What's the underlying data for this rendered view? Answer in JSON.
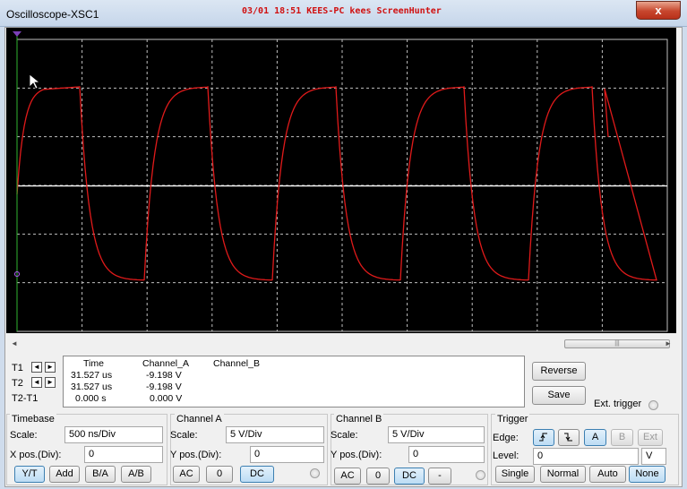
{
  "window": {
    "title": "Oscilloscope-XSC1",
    "watermark": "03/01 18:51 KEES-PC kees ScreenHunter",
    "close_icon": "x"
  },
  "display": {
    "background": "#000000",
    "grid_color": "#bfbfbf",
    "trace_color": "#e01a1a",
    "baseline_color": "#ffffff",
    "cursor_color": "#2fb32f"
  },
  "scrollbar": {
    "left_arrow": "◄",
    "right_arrow": "►",
    "thumb_grip": "|||"
  },
  "readout": {
    "headers": {
      "time": "Time",
      "channel_a": "Channel_A",
      "channel_b": "Channel_B"
    },
    "rows": [
      {
        "label": "T1",
        "time": "31.527 us",
        "channel_a": "-9.198 V",
        "channel_b": ""
      },
      {
        "label": "T2",
        "time": "31.527 us",
        "channel_a": "-9.198 V",
        "channel_b": ""
      },
      {
        "label": "T2-T1",
        "time": "0.000 s",
        "channel_a": "0.000 V",
        "channel_b": ""
      }
    ],
    "arrows": {
      "left": "◄",
      "right": "►"
    }
  },
  "buttons": {
    "reverse": "Reverse",
    "save": "Save",
    "ext_trigger": "Ext. trigger"
  },
  "timebase": {
    "title": "Timebase",
    "scale_label": "Scale:",
    "scale_value": "500 ns/Div",
    "xpos_label": "X pos.(Div):",
    "xpos_value": "0",
    "modes": [
      "Y/T",
      "Add",
      "B/A",
      "A/B"
    ],
    "active_mode": "Y/T"
  },
  "channel_a": {
    "title": "Channel A",
    "scale_label": "Scale:",
    "scale_value": "5  V/Div",
    "ypos_label": "Y pos.(Div):",
    "ypos_value": "0",
    "couplings": [
      "AC",
      "0",
      "DC"
    ],
    "active_coupling": "DC"
  },
  "channel_b": {
    "title": "Channel B",
    "scale_label": "Scale:",
    "scale_value": "5  V/Div",
    "ypos_label": "Y pos.(Div):",
    "ypos_value": "0",
    "couplings": [
      "AC",
      "0",
      "DC",
      "-"
    ],
    "active_coupling": "DC"
  },
  "trigger": {
    "title": "Trigger",
    "edge_label": "Edge:",
    "edge_rising_icon": "rising-edge",
    "edge_falling_icon": "falling-edge",
    "sources": [
      "A",
      "B",
      "Ext"
    ],
    "active_source": "A",
    "level_label": "Level:",
    "level_value": "0",
    "level_unit": "V",
    "modes": [
      "Single",
      "Normal",
      "Auto",
      "None"
    ],
    "active_mode": "None"
  }
}
